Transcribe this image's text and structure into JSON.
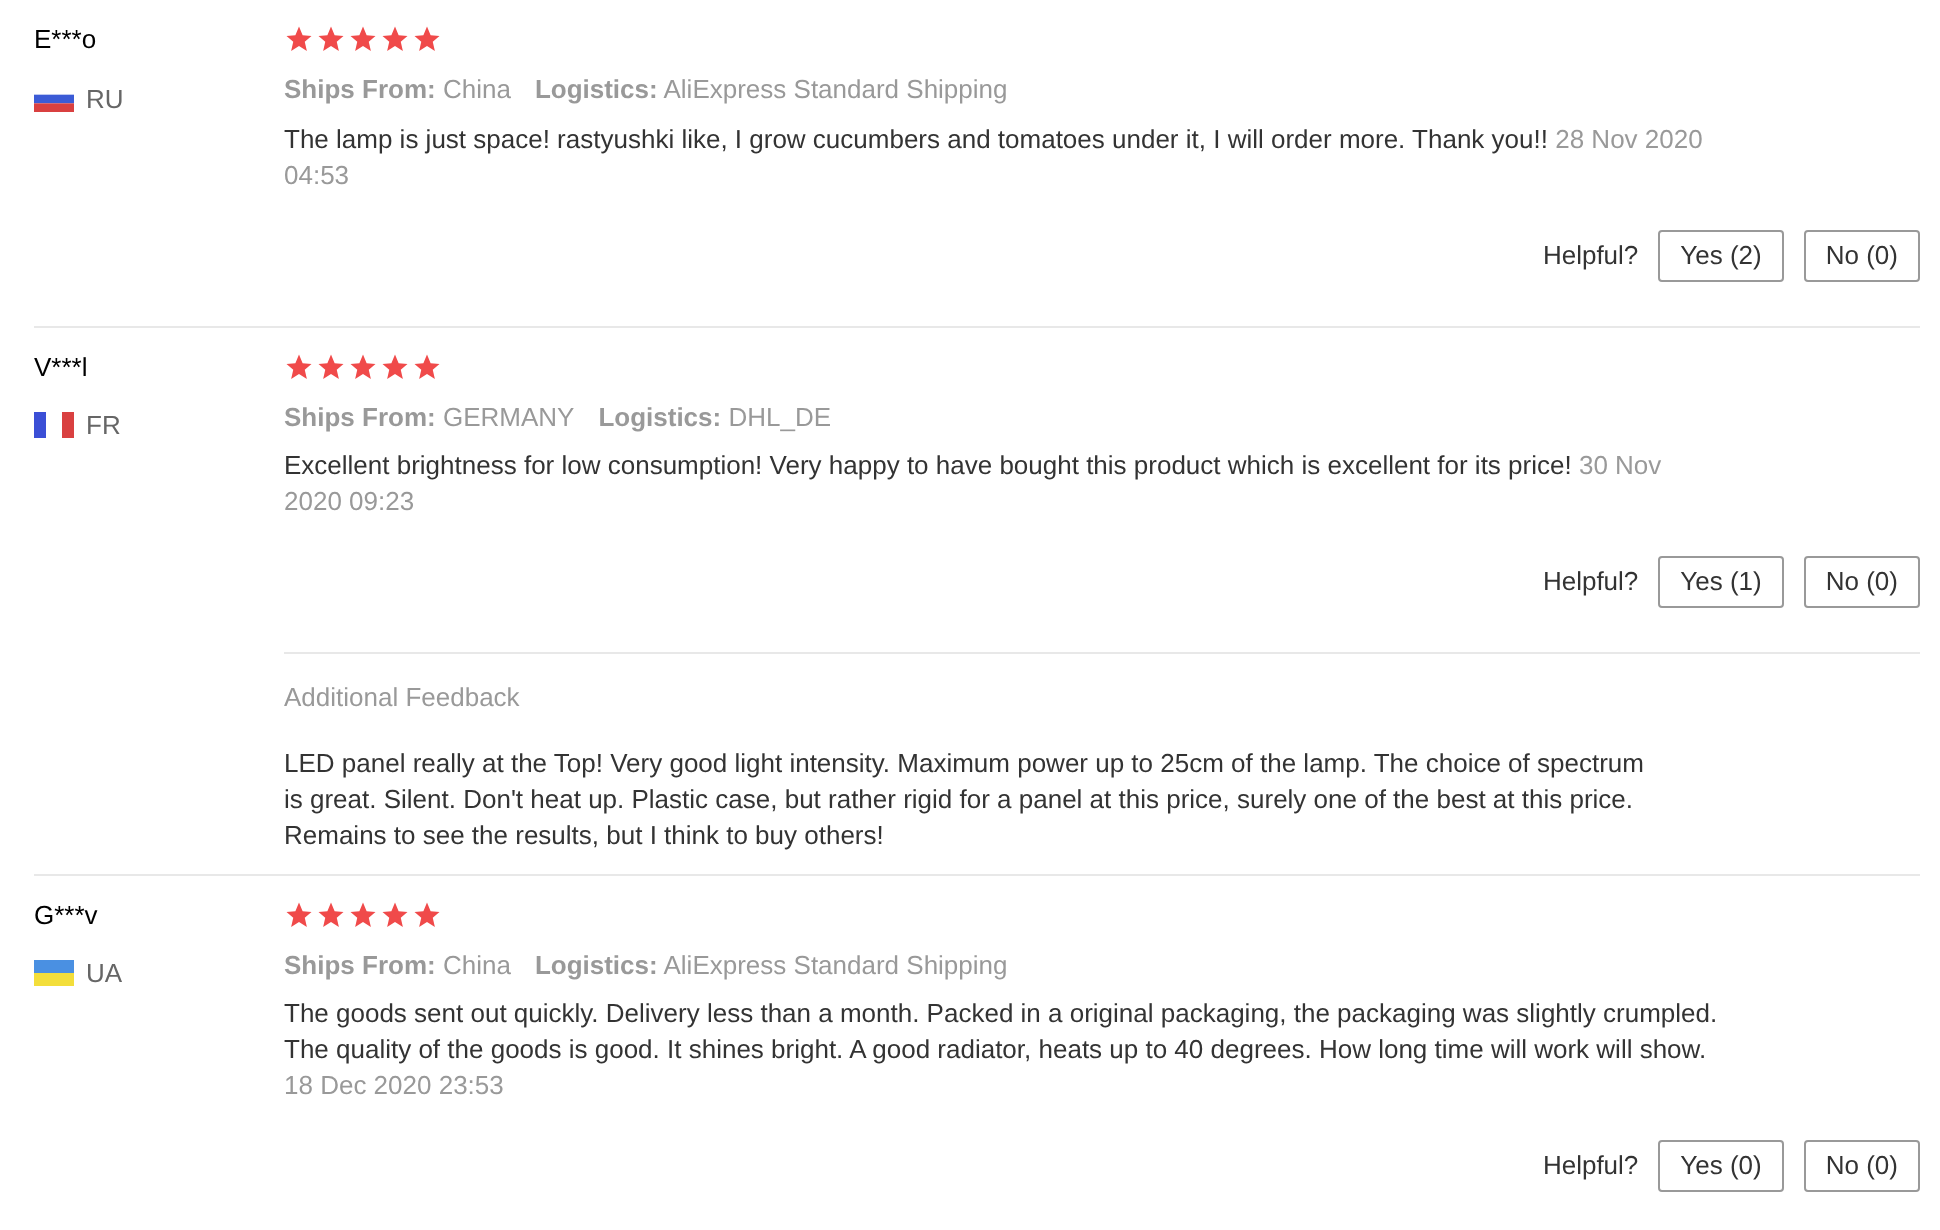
{
  "reviews": [
    {
      "name": "E***o",
      "kind": "ru",
      "country": "RU",
      "stars": 5,
      "ships_from_label": "Ships From:",
      "ships_from": "China",
      "logistics_label": "Logistics:",
      "logistics": "AliExpress Standard Shipping",
      "text": "The lamp is just space! rastyushki like, I grow cucumbers and tomatoes under it, I will order more. Thank you!!",
      "date": "28 Nov 2020 04:53",
      "helpful_label": "Helpful?",
      "yes": "Yes (2)",
      "no": "No (0)"
    },
    {
      "name": "V***l",
      "kind": "fr",
      "country": "FR",
      "stars": 5,
      "ships_from_label": "Ships From:",
      "ships_from": "GERMANY",
      "logistics_label": "Logistics:",
      "logistics": "DHL_DE",
      "text": "Excellent brightness for low consumption! Very happy to have bought this product which is excellent for its price!",
      "date": "30 Nov 2020 09:23",
      "helpful_label": "Helpful?",
      "yes": "Yes (1)",
      "no": "No (0)",
      "additional": {
        "title": "Additional Feedback",
        "text": "LED panel really at the Top! Very good light intensity. Maximum power up to 25cm of the lamp. The choice of spectrum is great. Silent. Don't heat up. Plastic case, but rather rigid for a panel at this price, surely one of the best at this price. Remains to see the results, but I think to buy others!"
      }
    },
    {
      "name": "G***v",
      "kind": "ua",
      "country": "UA",
      "stars": 5,
      "ships_from_label": "Ships From:",
      "ships_from": "China",
      "logistics_label": "Logistics:",
      "logistics": "AliExpress Standard Shipping",
      "text": "The goods sent out quickly. Delivery less than a month. Packed in a original packaging, the packaging was slightly crumpled. The quality of the goods is good. It shines bright. A good radiator, heats up to 40 degrees. How long time will work will show.",
      "date": "18 Dec 2020 23:53",
      "helpful_label": "Helpful?",
      "yes": "Yes (0)",
      "no": "No (0)"
    }
  ]
}
